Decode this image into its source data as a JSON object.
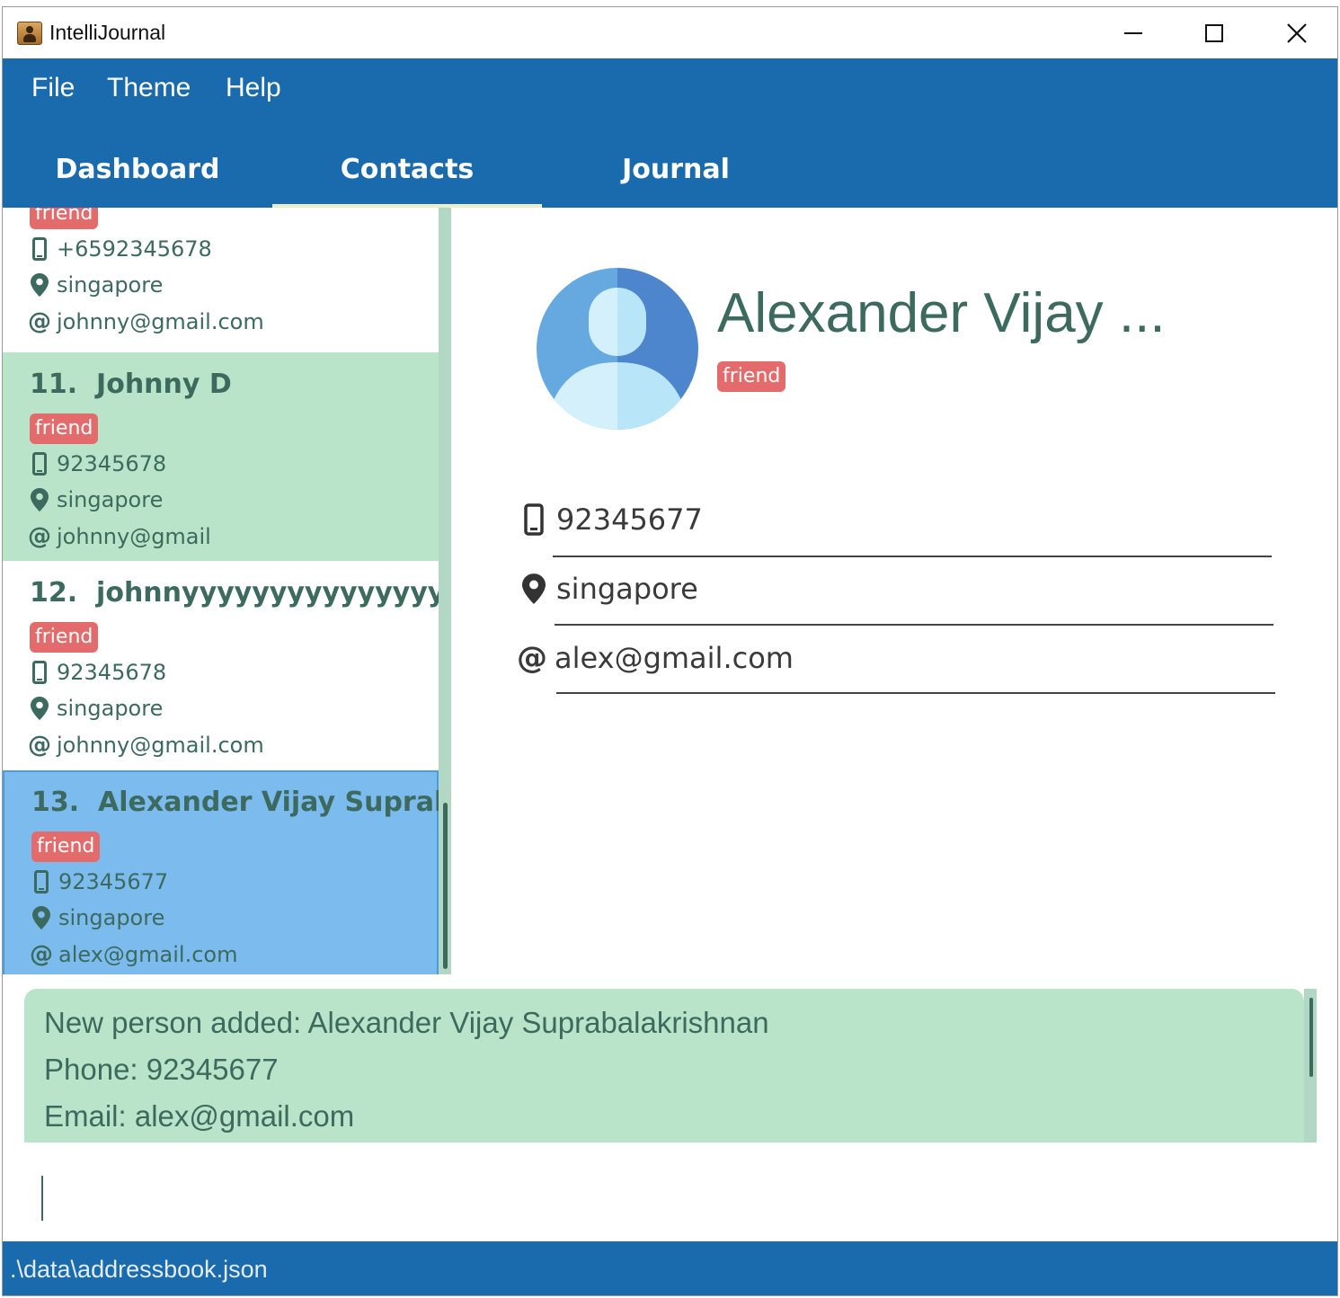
{
  "window": {
    "title": "IntelliJournal"
  },
  "menu": {
    "file": "File",
    "theme": "Theme",
    "help": "Help"
  },
  "tabs": [
    {
      "label": "Dashboard"
    },
    {
      "label": "Contacts"
    },
    {
      "label": "Journal"
    }
  ],
  "active_tab": "Contacts",
  "contacts": [
    {
      "tag": "friend",
      "phone": "+6592345678",
      "address": "singapore",
      "email": "johnny@gmail.com"
    },
    {
      "index": "11.",
      "name": "Johnny D",
      "tag": "friend",
      "phone": "92345678",
      "address": "singapore",
      "email": "johnny@gmail"
    },
    {
      "index": "12.",
      "name": "johnnyyyyyyyyyyyyyyy...",
      "tag": "friend",
      "phone": "92345678",
      "address": "singapore",
      "email": "johnny@gmail.com"
    },
    {
      "index": "13.",
      "name": "Alexander Vijay Supraba...",
      "tag": "friend",
      "phone": "92345677",
      "address": "singapore",
      "email": "alex@gmail.com",
      "selected": true
    }
  ],
  "detail": {
    "name": "Alexander Vijay ...",
    "tag": "friend",
    "phone": "92345677",
    "address": "singapore",
    "email": "alex@gmail.com"
  },
  "result": {
    "line1": "New person added: Alexander Vijay Suprabalakrishnan",
    "line2": "Phone: 92345677",
    "line3": "Email: alex@gmail.com"
  },
  "command": {
    "value": ""
  },
  "status": {
    "path": ".\\data\\addressbook.json"
  },
  "colors": {
    "primary": "#1a6aae",
    "card_alt": "#b9e4c9",
    "card_selected": "#7bbbee",
    "tag": "#e36b6b",
    "text": "#3d6a5e"
  }
}
